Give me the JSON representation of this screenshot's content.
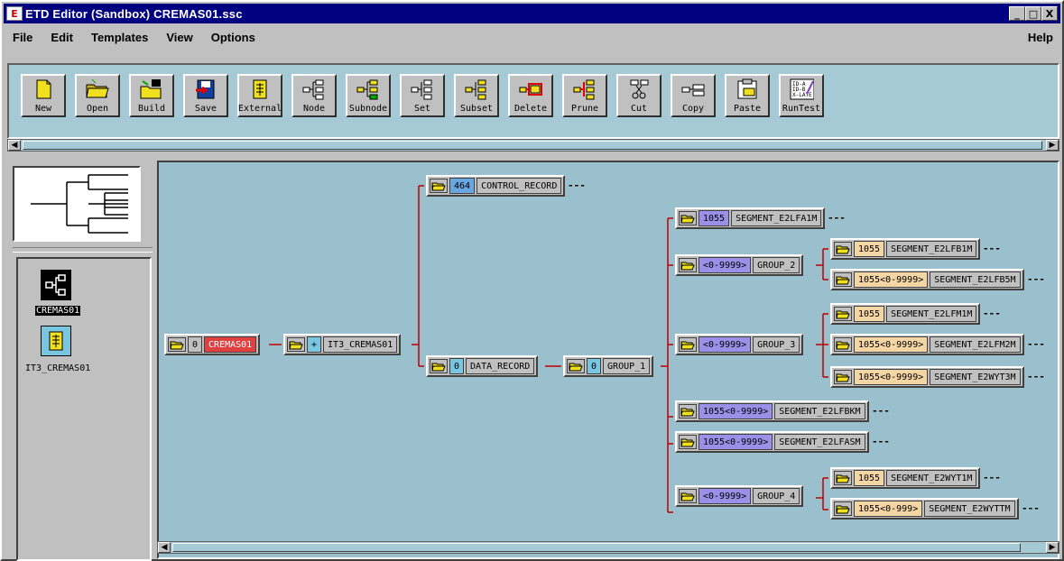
{
  "window": {
    "title": "ETD Editor (Sandbox)  CREMAS01.ssc",
    "controls": [
      "_",
      "□",
      "X"
    ]
  },
  "menu": {
    "items": [
      "File",
      "Edit",
      "Templates",
      "View",
      "Options"
    ],
    "help": "Help"
  },
  "toolbar": {
    "buttons": [
      {
        "label": "New",
        "icon": "new-file-icon"
      },
      {
        "label": "Open",
        "icon": "open-folder-icon"
      },
      {
        "label": "Build",
        "icon": "build-icon"
      },
      {
        "label": "Save",
        "icon": "save-disk-icon"
      },
      {
        "label": "External",
        "icon": "external-icon"
      },
      {
        "label": "Node",
        "icon": "node-icon"
      },
      {
        "label": "Subnode",
        "icon": "subnode-icon"
      },
      {
        "label": "Set",
        "icon": "set-icon"
      },
      {
        "label": "Subset",
        "icon": "subset-icon"
      },
      {
        "label": "Delete",
        "icon": "delete-node-icon"
      },
      {
        "label": "Prune",
        "icon": "prune-icon"
      },
      {
        "label": "Cut",
        "icon": "cut-scissors-icon"
      },
      {
        "label": "Copy",
        "icon": "copy-icon"
      },
      {
        "label": "Paste",
        "icon": "paste-icon"
      },
      {
        "label": "RunTest",
        "icon": "run-test-icon"
      }
    ]
  },
  "files": [
    {
      "label": "CREMAS01",
      "icon": "etd-tree-icon",
      "selected": true
    },
    {
      "label": "IT3_CREMAS01",
      "icon": "external-etd-icon",
      "selected": false
    }
  ],
  "tree": {
    "root": {
      "occ": "0",
      "name": "CREMAS01"
    },
    "it3": {
      "occ": "+",
      "name": "IT3_CREMAS01"
    },
    "control": {
      "occ": "464",
      "name": "CONTROL_RECORD",
      "more": "---"
    },
    "data": {
      "occ": "0",
      "name": "DATA_RECORD"
    },
    "group1": {
      "occ": "0",
      "name": "GROUP_1"
    },
    "e2lfa1m": {
      "occ": "1055",
      "name": "SEGMENT_E2LFA1M",
      "more": "---"
    },
    "group2": {
      "occ": "<0-9999>",
      "name": "GROUP_2"
    },
    "e2lfb1m": {
      "occ": "1055",
      "name": "SEGMENT_E2LFB1M",
      "more": "---"
    },
    "e2lfb5m": {
      "occ": "1055<0-9999>",
      "name": "SEGMENT_E2LFB5M",
      "more": "---"
    },
    "group3": {
      "occ": "<0-9999>",
      "name": "GROUP_3"
    },
    "e2lfm1m": {
      "occ": "1055",
      "name": "SEGMENT_E2LFM1M",
      "more": "---"
    },
    "e2lfm2m": {
      "occ": "1055<0-9999>",
      "name": "SEGMENT_E2LFM2M",
      "more": "---"
    },
    "e2wyt3m": {
      "occ": "1055<0-9999>",
      "name": "SEGMENT_E2WYT3M",
      "more": "---"
    },
    "e2lfbkm": {
      "occ": "1055<0-9999>",
      "name": "SEGMENT_E2LFBKM",
      "more": "---"
    },
    "e2lfasm": {
      "occ": "1055<0-9999>",
      "name": "SEGMENT_E2LFASM",
      "more": "---"
    },
    "group4": {
      "occ": "<0-9999>",
      "name": "GROUP_4"
    },
    "e2wyt1m": {
      "occ": "1055",
      "name": "SEGMENT_E2WYT1M",
      "more": "---"
    },
    "e2wyttm": {
      "occ": "1055<0-999>",
      "name": "SEGMENT_E2WYTTM",
      "more": "---"
    }
  },
  "colors": {
    "canvas": "#9bc0cd",
    "toolbar": "#a6c9d6",
    "title_bar": "#000080",
    "link_red": "#c00000"
  }
}
